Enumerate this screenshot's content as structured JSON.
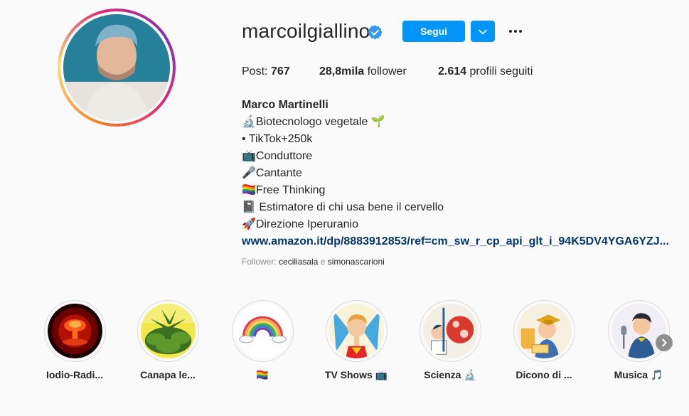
{
  "profile": {
    "username": "marcoilgiallino",
    "follow_label": "Segui",
    "stats": {
      "posts_label": "Post:",
      "posts_value": "767",
      "followers_value": "28,8mila",
      "followers_label": "follower",
      "following_value": "2.614",
      "following_label": "profili seguiti"
    },
    "full_name": "Marco Martinelli",
    "bio_lines": [
      "🔬Biotecnologo vegetale 🌱",
      "• TikTok+250k",
      "📺Conduttore",
      "🎤Cantante",
      "🏳️‍🌈Free Thinking",
      "📓 Estimatore di chi usa bene il cervello",
      "🚀Direzione Iperuranio"
    ],
    "link": "www.amazon.it/dp/8883912853/ref=cm_sw_r_cp_api_glt_i_94K5DV4YGA6YZJ...",
    "followed_by": {
      "prefix": "Follower:",
      "user1": "ceciliasala",
      "conj": "e",
      "user2": "simonascarioni"
    }
  },
  "highlights": [
    {
      "label": "Iodio-Radi...",
      "icon": "mushroom-cloud-image"
    },
    {
      "label": "Canapa le...",
      "icon": "cannabis-plant-image"
    },
    {
      "label": "🏳️‍🌈",
      "icon": "rainbow-image"
    },
    {
      "label": "TV Shows 📺",
      "icon": "superhero-cartoon-image"
    },
    {
      "label": "Scienza 🔬",
      "icon": "science-cartoon-image"
    },
    {
      "label": "Dicono di ...",
      "icon": "graduate-cartoon-image"
    },
    {
      "label": "Musica 🎵",
      "icon": "singer-cartoon-image"
    }
  ],
  "colors": {
    "accent": "#0095f6",
    "link": "#00376b",
    "verified": "#3897f0"
  }
}
